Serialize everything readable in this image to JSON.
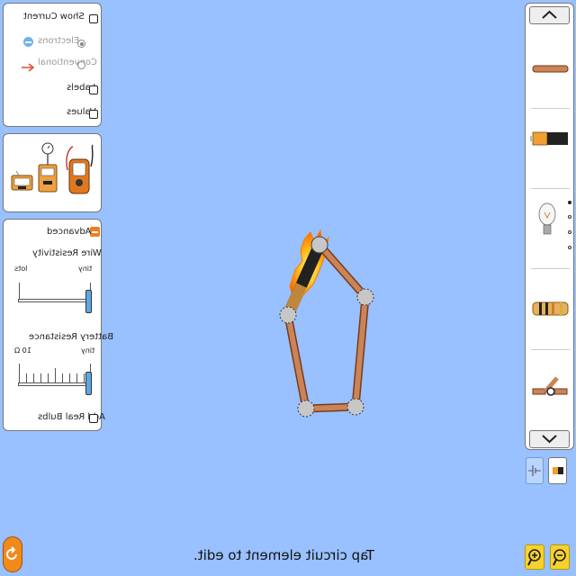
{
  "view_panel": {
    "show_current": "Show Current",
    "electrons": "Electrons",
    "conventional": "Conventional",
    "labels": "Labels",
    "values": "Values"
  },
  "advanced_panel": {
    "title": "Advanced",
    "wire_resistivity": {
      "label": "Wire Resistivity",
      "min_label": "tiny",
      "max_label": "lots",
      "value_fraction": 0.0
    },
    "battery_resistance": {
      "label": "Battery Resistance",
      "min_label": "tiny",
      "max_label": "10 Ω",
      "value_fraction": 0.0
    },
    "add_real_bulbs": "Add Real Bulbs"
  },
  "toolbox": {
    "items": [
      "wire-icon",
      "battery-icon",
      "light-bulb-icon",
      "resistor-icon",
      "switch-icon"
    ],
    "page_count": 4,
    "current_page": 1
  },
  "status_message": "Tap circuit element to edit.",
  "colors": {
    "background": "#99c0ff",
    "wire": "#c98458",
    "fire": "#ff8c1a",
    "accent": "#f6d22c"
  }
}
